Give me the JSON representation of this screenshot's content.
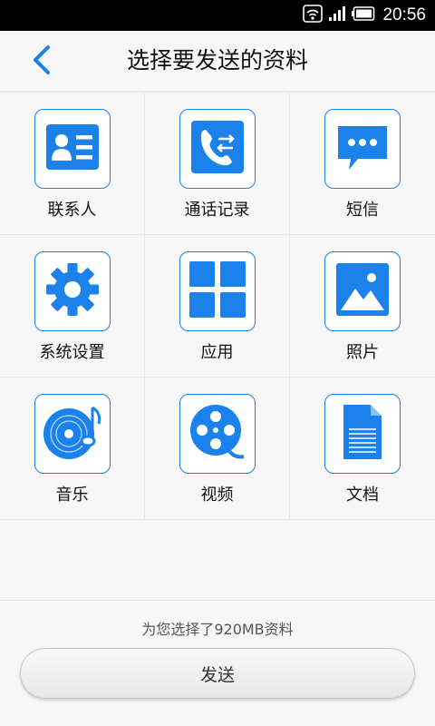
{
  "status_bar": {
    "time": "20:56",
    "icons": [
      "wifi-icon",
      "signal-icon",
      "battery-icon"
    ]
  },
  "header": {
    "back_icon": "chevron-left-icon",
    "title": "选择要发送的资料"
  },
  "categories": [
    {
      "label": "联系人",
      "icon": "contact-card-icon"
    },
    {
      "label": "通话记录",
      "icon": "call-log-icon"
    },
    {
      "label": "短信",
      "icon": "sms-icon"
    },
    {
      "label": "系统设置",
      "icon": "gear-icon"
    },
    {
      "label": "应用",
      "icon": "apps-grid-icon"
    },
    {
      "label": "照片",
      "icon": "photo-icon"
    },
    {
      "label": "音乐",
      "icon": "music-disc-icon"
    },
    {
      "label": "视频",
      "icon": "film-reel-icon"
    },
    {
      "label": "文档",
      "icon": "document-icon"
    }
  ],
  "footer": {
    "summary": "为您选择了920MB资料",
    "send_label": "发送"
  },
  "colors": {
    "accent": "#1a82ea",
    "background": "#f7f7f7",
    "status_bar": "#000000"
  }
}
